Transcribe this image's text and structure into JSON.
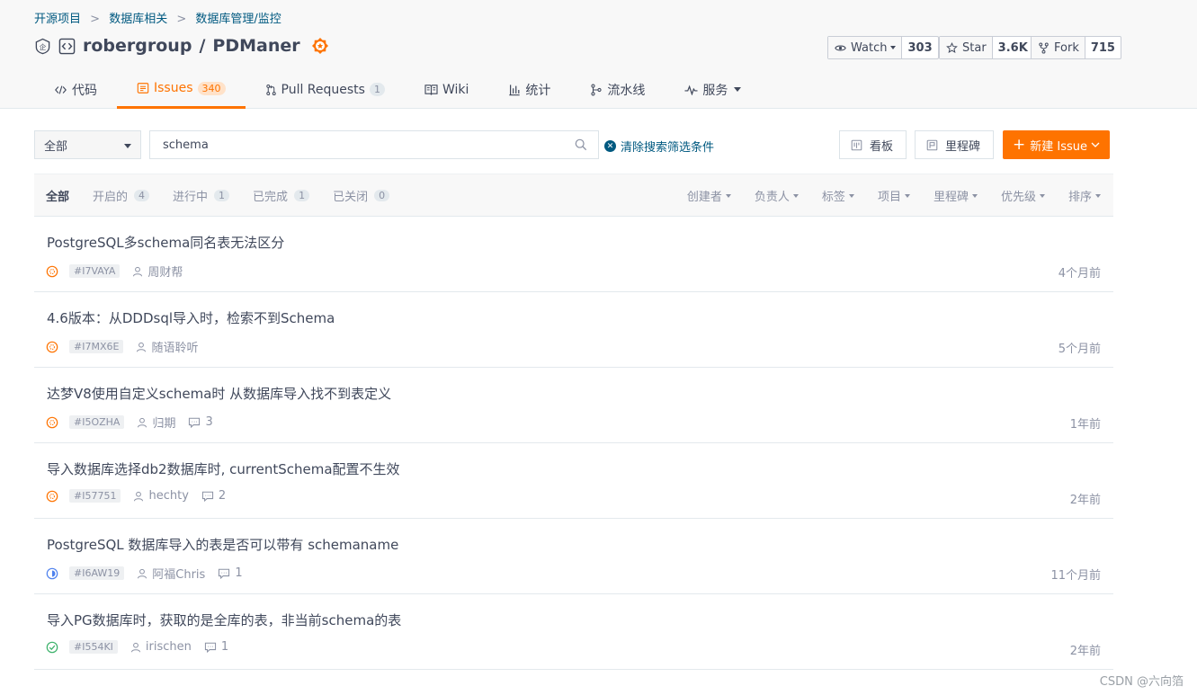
{
  "breadcrumb": {
    "items": [
      "开源项目",
      "数据库相关",
      "数据库管理/监控"
    ],
    "separator": ">"
  },
  "repo": {
    "owner": "robergroup",
    "separator": "/",
    "name": "PDManer"
  },
  "social": {
    "watch_label": "Watch",
    "watch_count": "303",
    "star_label": "Star",
    "star_count": "3.6K",
    "fork_label": "Fork",
    "fork_count": "715"
  },
  "tabs": [
    {
      "label": "代码",
      "icon": "code-icon"
    },
    {
      "label": "Issues",
      "count": "340",
      "icon": "issues-icon",
      "active": true
    },
    {
      "label": "Pull Requests",
      "count": "1",
      "icon": "pull-request-icon"
    },
    {
      "label": "Wiki",
      "icon": "book-icon"
    },
    {
      "label": "统计",
      "icon": "bar-chart-icon"
    },
    {
      "label": "流水线",
      "icon": "pipeline-icon"
    },
    {
      "label": "服务",
      "icon": "pulse-icon"
    }
  ],
  "filter": {
    "scope_value": "全部",
    "search_value": "schema",
    "clear_label": "清除搜索筛选条件",
    "board_label": "看板",
    "milestone_label": "里程碑",
    "new_issue_label": "新建 Issue"
  },
  "states": [
    {
      "label": "全部",
      "active": true
    },
    {
      "label": "开启的",
      "count": "4"
    },
    {
      "label": "进行中",
      "count": "1"
    },
    {
      "label": "已完成",
      "count": "1"
    },
    {
      "label": "已关闭",
      "count": "0"
    }
  ],
  "sorts": [
    "创建者",
    "负责人",
    "标签",
    "项目",
    "里程碑",
    "优先级",
    "排序"
  ],
  "issues": [
    {
      "title": "PostgreSQL多schema同名表无法区分",
      "id": "#I7VAYA",
      "author": "周财帮",
      "comments": "",
      "time": "4个月前",
      "status": "open"
    },
    {
      "title": "4.6版本：从DDDsql导入时，检索不到Schema",
      "id": "#I7MX6E",
      "author": "随语聆听",
      "comments": "",
      "time": "5个月前",
      "status": "open"
    },
    {
      "title": "达梦V8使用自定义schema时 从数据库导入找不到表定义",
      "id": "#I5OZHA",
      "author": "归期",
      "comments": "3",
      "time": "1年前",
      "status": "open"
    },
    {
      "title": "导入数据库选择db2数据库时, currentSchema配置不生效",
      "id": "#I57751",
      "author": "hechty",
      "comments": "2",
      "time": "2年前",
      "status": "open"
    },
    {
      "title": "PostgreSQL 数据库导入的表是否可以带有 schemaname",
      "id": "#I6AW19",
      "author": "阿福Chris",
      "comments": "1",
      "time": "11个月前",
      "status": "progressing"
    },
    {
      "title": "导入PG数据库时，获取的是全库的表，非当前schema的表",
      "id": "#I554KI",
      "author": "irischen",
      "comments": "1",
      "time": "2年前",
      "status": "done"
    }
  ],
  "colors": {
    "accent": "#fe7300",
    "link": "#005980",
    "open": "#fe7300",
    "progressing": "#4e81ee",
    "done": "#3bb16a"
  },
  "watermark": "CSDN @六向箔"
}
